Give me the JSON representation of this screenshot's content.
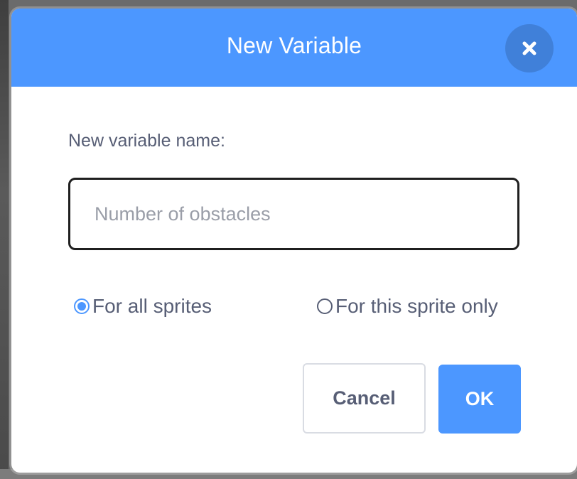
{
  "dialog": {
    "title": "New Variable",
    "close_icon": "close-icon"
  },
  "form": {
    "name_label": "New variable name:",
    "name_input": {
      "value": "",
      "placeholder": "Number of obstacles"
    },
    "scope_options": [
      {
        "label": "For all sprites",
        "checked": true
      },
      {
        "label": "For this sprite only",
        "checked": false
      }
    ]
  },
  "actions": {
    "cancel_label": "Cancel",
    "ok_label": "OK"
  },
  "colors": {
    "accent": "#4c97ff",
    "text": "#575e75"
  }
}
